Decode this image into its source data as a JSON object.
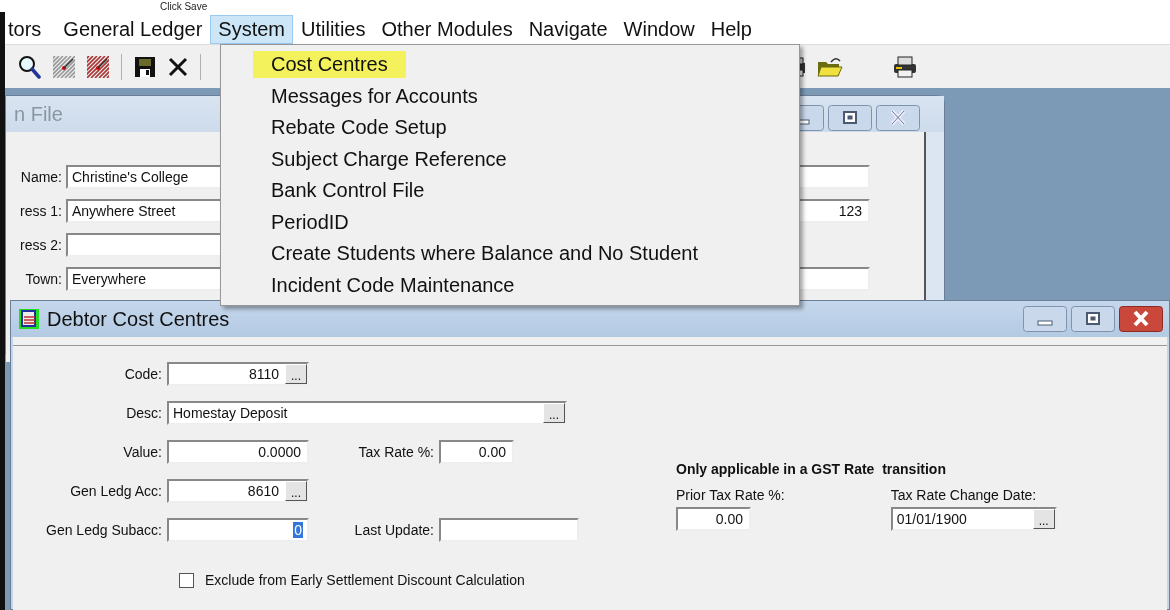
{
  "caption": "Click Save",
  "menu_bar": [
    {
      "label": "tors",
      "selected": false
    },
    {
      "label": "General Ledger",
      "selected": false
    },
    {
      "label": "System",
      "selected": true
    },
    {
      "label": "Utilities",
      "selected": false
    },
    {
      "label": "Other Modules",
      "selected": false
    },
    {
      "label": "Navigate",
      "selected": false
    },
    {
      "label": "Window",
      "selected": false
    },
    {
      "label": "Help",
      "selected": false
    }
  ],
  "dropdown_menu": [
    {
      "label": "Cost Centres",
      "selected": true
    },
    {
      "label": "Messages for Accounts",
      "selected": false
    },
    {
      "label": "Rebate Code Setup",
      "selected": false
    },
    {
      "label": "Subject Charge Reference",
      "selected": false
    },
    {
      "label": "Bank Control File",
      "selected": false
    },
    {
      "label": "PeriodID",
      "selected": false
    },
    {
      "label": "Create Students where Balance and No Student",
      "selected": false
    },
    {
      "label": "Incident Code Maintenance",
      "selected": false
    }
  ],
  "back_window": {
    "title": "n File",
    "active": false,
    "fields": [
      {
        "label": "Name:",
        "value": "Christine's  College",
        "side_field": true
      },
      {
        "label": "ress 1:",
        "value": "Anywhere Street",
        "side_value": "123"
      },
      {
        "label": "ress 2:"
      },
      {
        "label": "Town:",
        "value": "Everywhere",
        "side_field": true
      }
    ]
  },
  "front_window": {
    "title": "Debtor Cost Centres",
    "active": true,
    "rows": [
      [
        {
          "label": "Code:",
          "value": "8110",
          "kind": "number",
          "lookup": "..."
        }
      ],
      [
        {
          "label": "Desc:",
          "value": "Homestay Deposit",
          "kind": "text",
          "lookup": "..."
        }
      ],
      [
        {
          "label": "Value:",
          "value": "0.0000",
          "kind": "number"
        },
        {
          "label": "Tax Rate %:",
          "value": "0.00",
          "kind": "rate"
        }
      ],
      [
        {
          "label": "Gen Ledg Acc:",
          "value": "8610",
          "kind": "number",
          "lookup": "..."
        }
      ],
      [
        {
          "label": "Gen Ledg Subacc:",
          "value": "0",
          "kind": "number",
          "highlighted": true
        },
        {
          "label": "Last Update:",
          "kind": "date"
        }
      ]
    ],
    "gst": {
      "heading": "Only applicable in a GST Rate  transition",
      "fields": [
        {
          "label": "Prior Tax Rate %:",
          "value": "0.00",
          "kind": "rate"
        },
        {
          "label": "Tax Rate Change Date:",
          "value": "01/01/1900",
          "kind": "date",
          "lookup": "..."
        }
      ]
    },
    "checkbox": {
      "label": "Exclude from Early Settlement Discount Calculation",
      "checked": false
    }
  }
}
